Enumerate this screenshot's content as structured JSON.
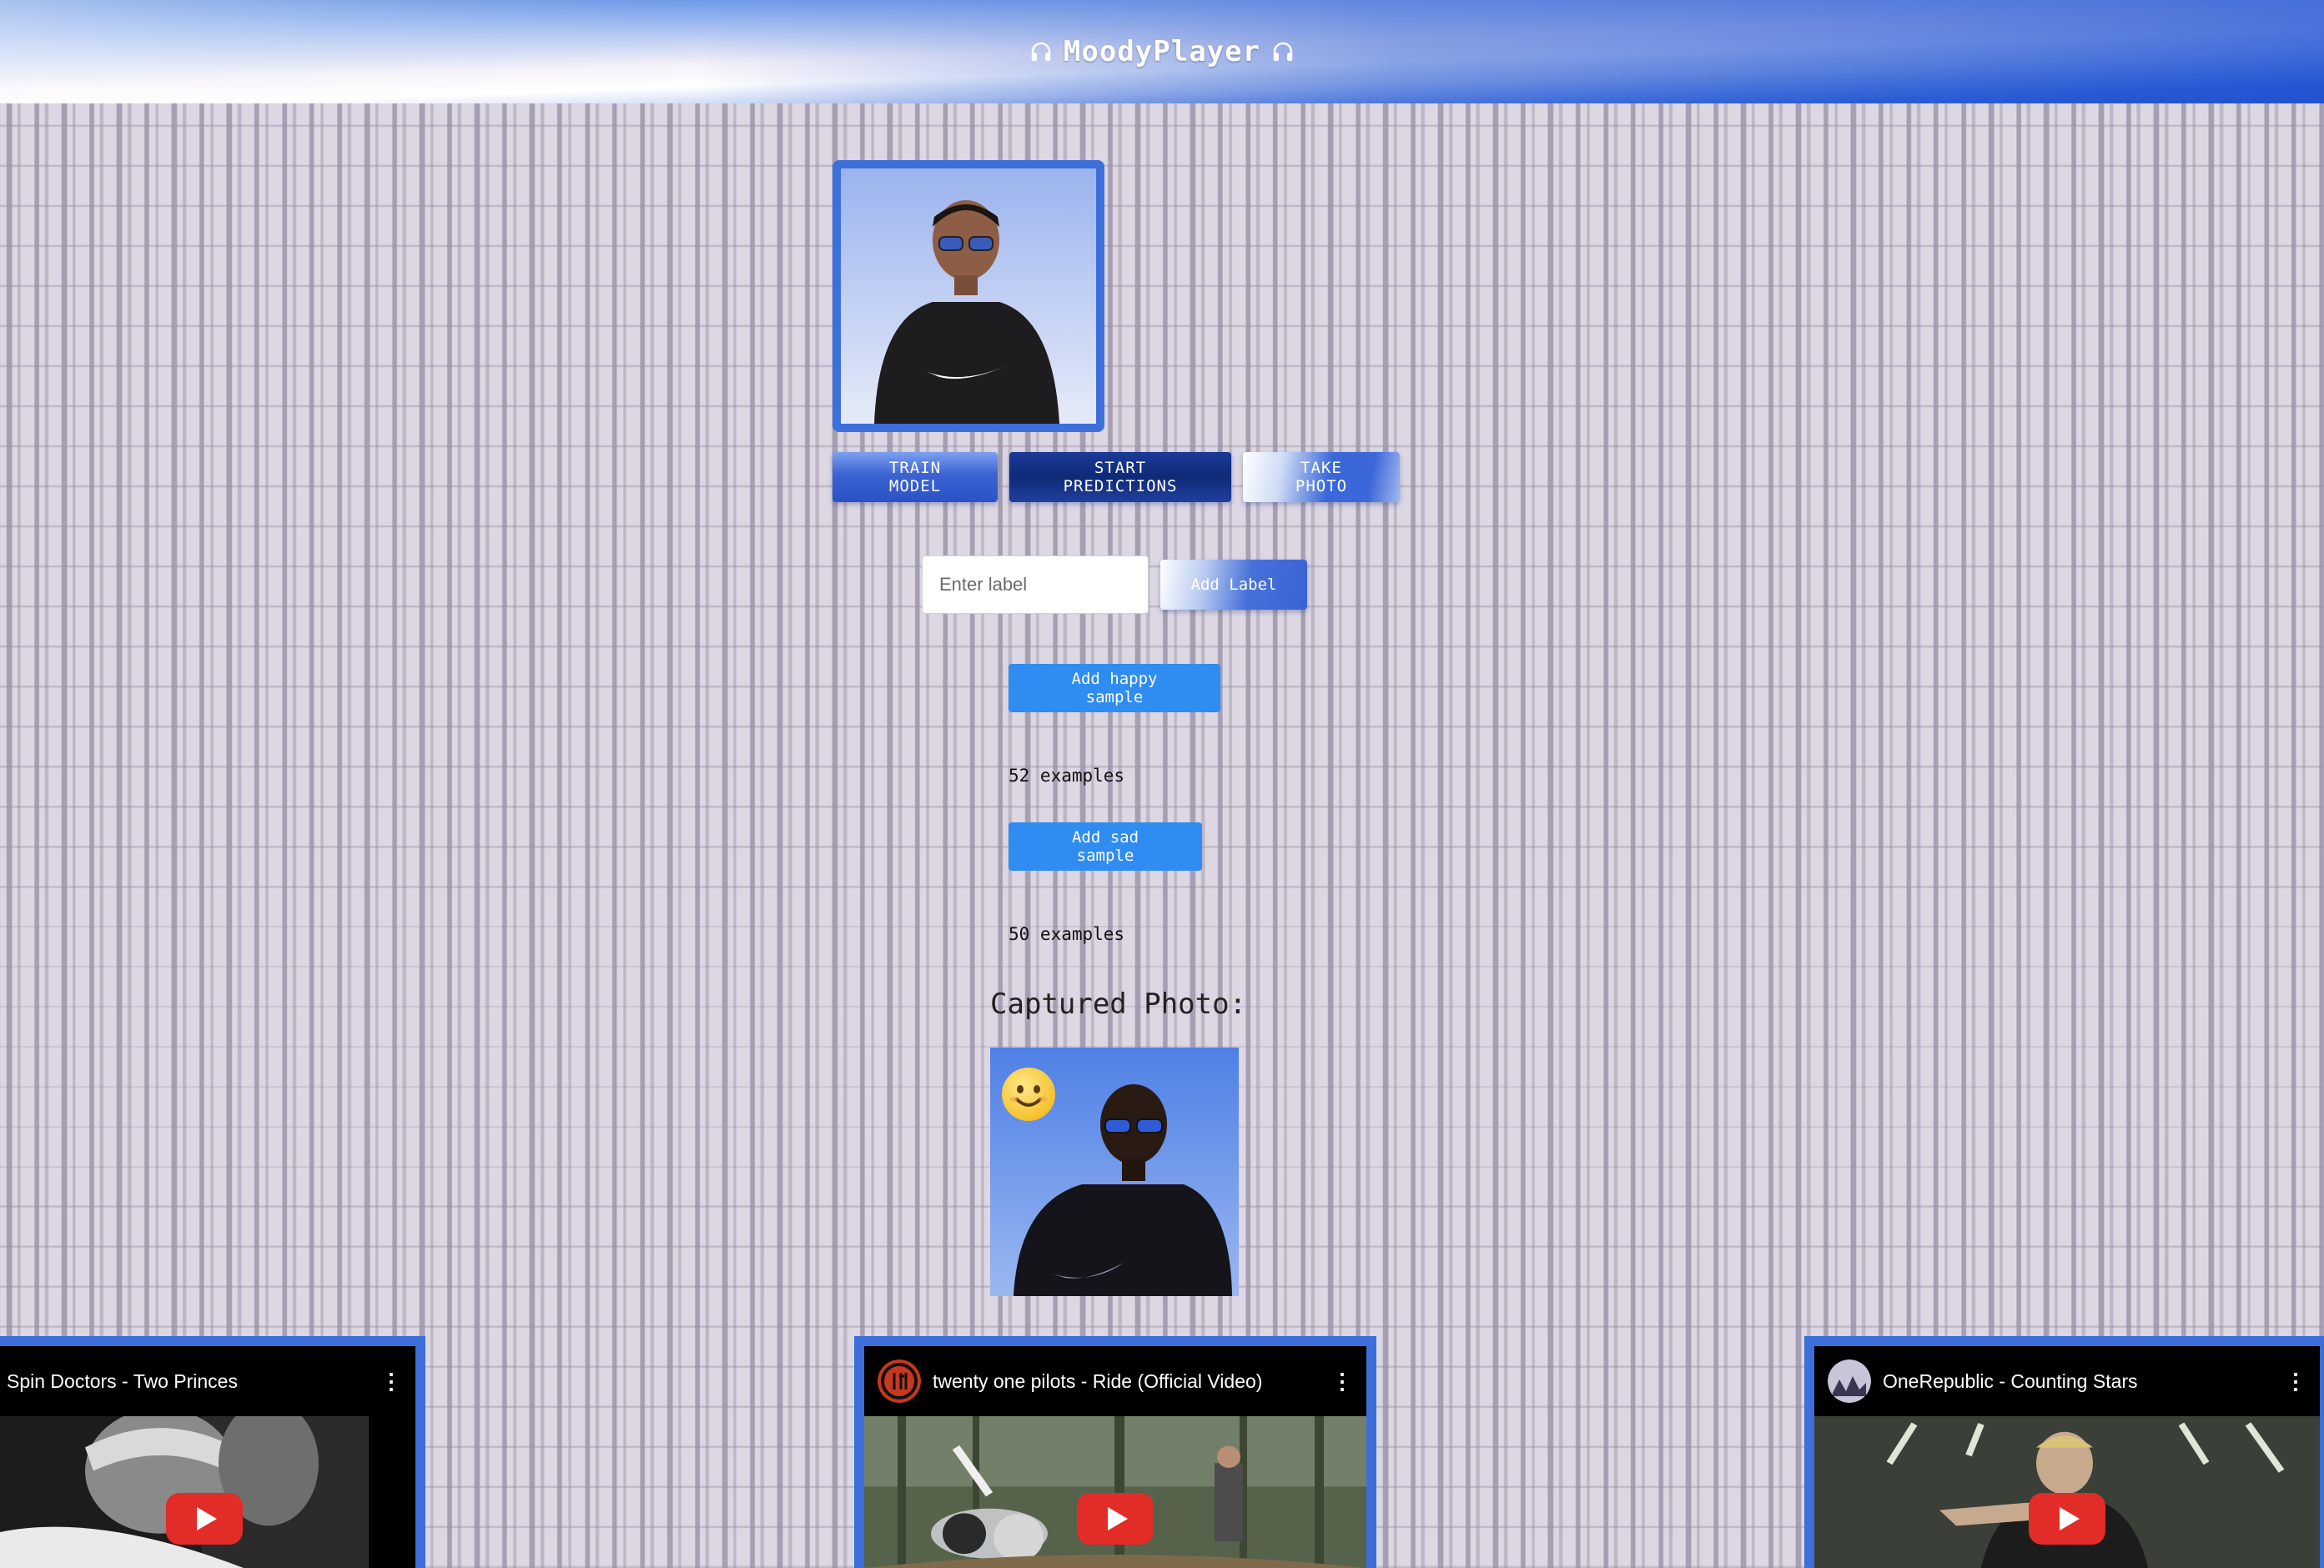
{
  "header": {
    "title": "MoodyPlayer",
    "left_icon": "headphones-icon",
    "right_icon": "headphones-icon"
  },
  "controls": {
    "train_label": "TRAIN MODEL",
    "predict_label": "START PREDICTIONS",
    "photo_label": "TAKE PHOTO"
  },
  "label_form": {
    "placeholder": "Enter label",
    "value": "",
    "add_label": "Add Label"
  },
  "samples": [
    {
      "button": "Add happy sample",
      "count": "52 examples"
    },
    {
      "button": "Add sad sample",
      "count": "50 examples"
    }
  ],
  "captured": {
    "title": "Captured Photo:",
    "emoji_icon": "smiling-face-icon"
  },
  "videos": [
    {
      "title": "Spin Doctors - Two Princes"
    },
    {
      "title": "twenty one pilots - Ride (Official Video)"
    },
    {
      "title": "OneRepublic - Counting Stars"
    }
  ],
  "colors": {
    "accent_blue": "#3d6fdb",
    "sample_button": "#2f8cf0",
    "youtube_red": "#e22c27"
  }
}
